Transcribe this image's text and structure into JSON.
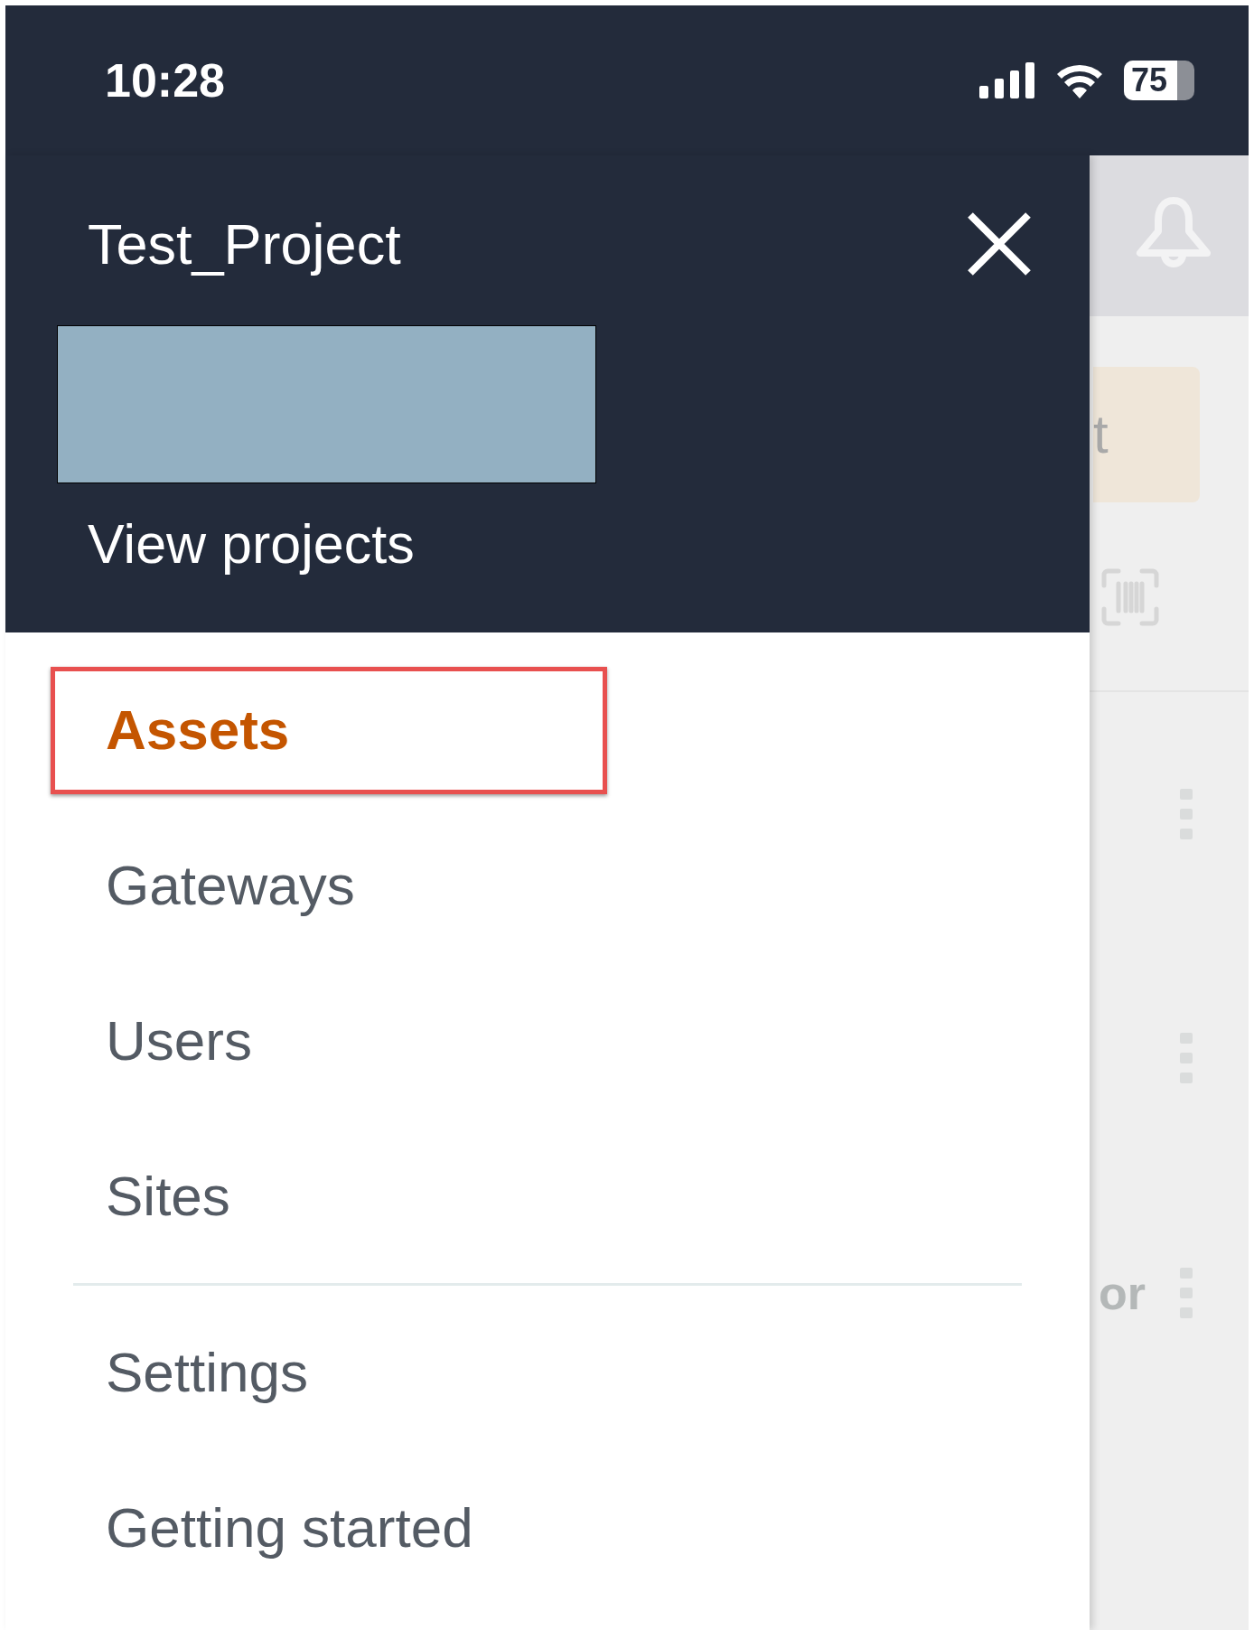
{
  "status_bar": {
    "time": "10:28",
    "battery": "75"
  },
  "drawer": {
    "title": "Test_Project",
    "view_projects": "View projects",
    "items": [
      {
        "label": "Assets",
        "selected": true,
        "highlighted": true
      },
      {
        "label": "Gateways",
        "selected": false,
        "highlighted": false
      },
      {
        "label": "Users",
        "selected": false,
        "highlighted": false
      },
      {
        "label": "Sites",
        "selected": false,
        "highlighted": false
      }
    ],
    "secondary_items": [
      {
        "label": "Settings",
        "selected": false
      },
      {
        "label": "Getting started",
        "selected": false
      }
    ]
  },
  "background": {
    "button_text": "t",
    "row_text": "or"
  }
}
